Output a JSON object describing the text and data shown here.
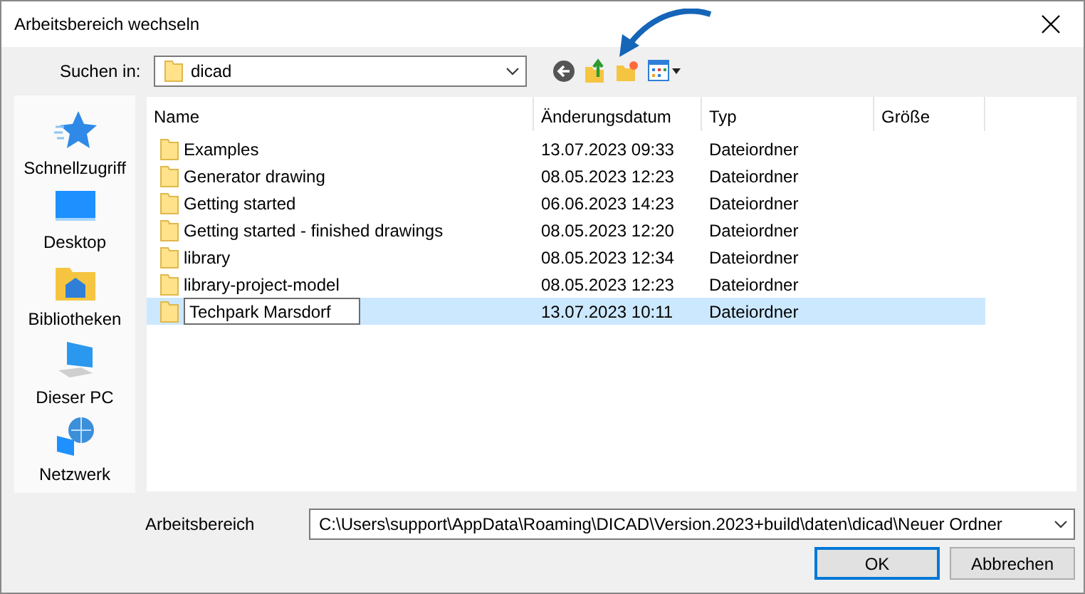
{
  "window": {
    "title": "Arbeitsbereich wechseln"
  },
  "look_in": {
    "label": "Suchen in:",
    "value": "dicad"
  },
  "places": [
    {
      "label": "Schnellzugriff",
      "kind": "star"
    },
    {
      "label": "Desktop",
      "kind": "desktop"
    },
    {
      "label": "Bibliotheken",
      "kind": "library"
    },
    {
      "label": "Dieser PC",
      "kind": "pc"
    },
    {
      "label": "Netzwerk",
      "kind": "network"
    }
  ],
  "columns": [
    "Name",
    "Änderungsdatum",
    "Typ",
    "Größe"
  ],
  "rows": [
    {
      "name": "Examples",
      "date": "13.07.2023 09:33",
      "type": "Dateiordner",
      "selected": false,
      "renaming": false
    },
    {
      "name": "Generator drawing",
      "date": "08.05.2023 12:23",
      "type": "Dateiordner",
      "selected": false,
      "renaming": false
    },
    {
      "name": "Getting started",
      "date": "06.06.2023 14:23",
      "type": "Dateiordner",
      "selected": false,
      "renaming": false
    },
    {
      "name": "Getting started - finished drawings",
      "date": "08.05.2023 12:20",
      "type": "Dateiordner",
      "selected": false,
      "renaming": false
    },
    {
      "name": "library",
      "date": "08.05.2023 12:34",
      "type": "Dateiordner",
      "selected": false,
      "renaming": false
    },
    {
      "name": "library-project-model",
      "date": "08.05.2023 12:23",
      "type": "Dateiordner",
      "selected": false,
      "renaming": false
    },
    {
      "name": "Techpark Marsdorf",
      "date": "13.07.2023 10:11",
      "type": "Dateiordner",
      "selected": true,
      "renaming": true
    }
  ],
  "workspace": {
    "label": "Arbeitsbereich",
    "value": "C:\\Users\\support\\AppData\\Roaming\\DICAD\\Version.2023+build\\daten\\dicad\\Neuer Ordner"
  },
  "buttons": [
    {
      "label": "OK",
      "default": true
    },
    {
      "label": "Abbrechen",
      "default": false
    }
  ]
}
